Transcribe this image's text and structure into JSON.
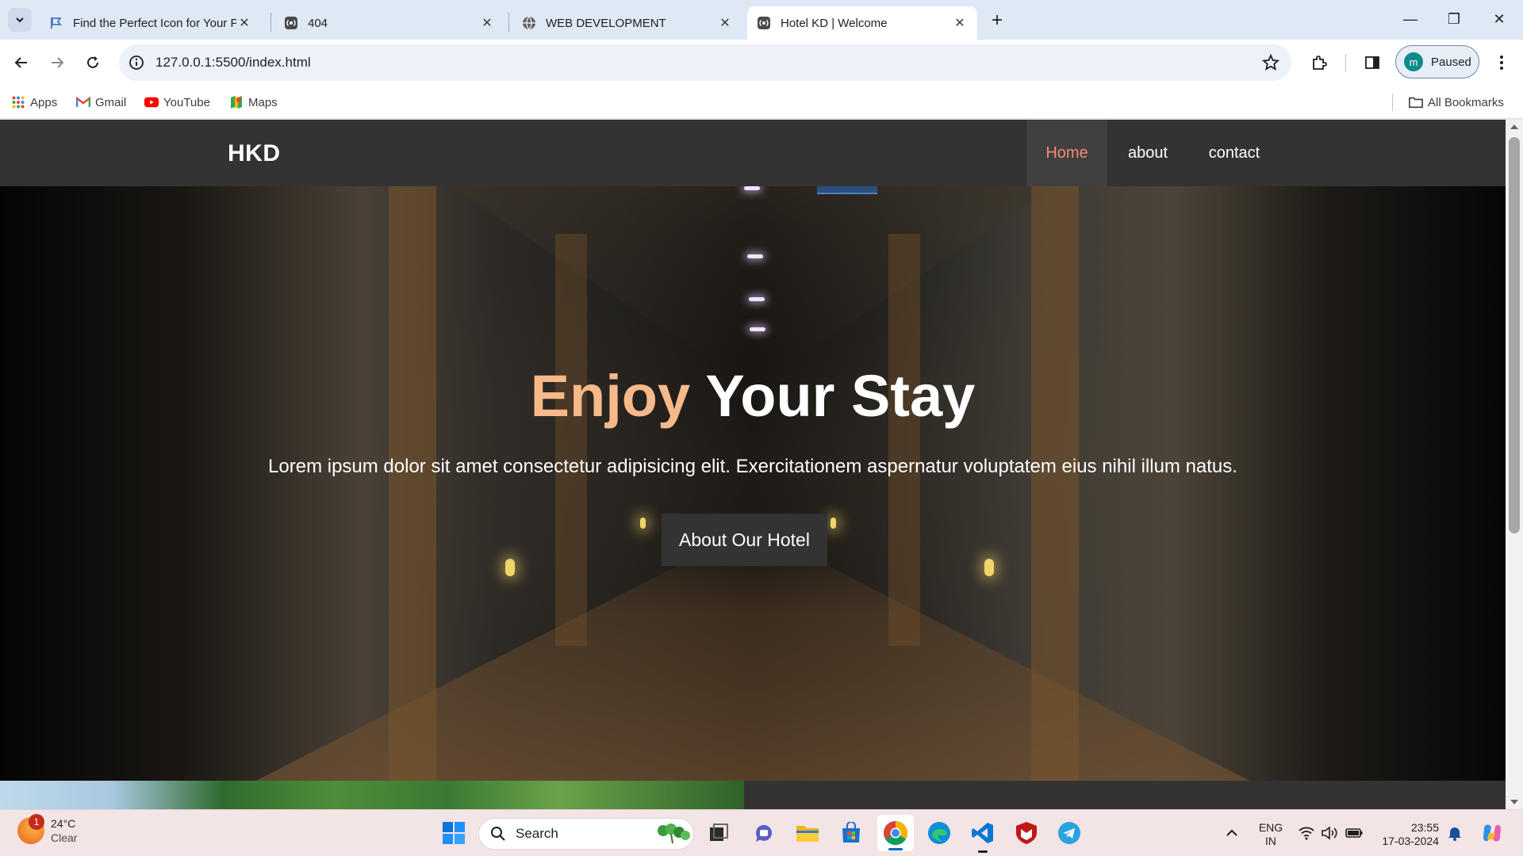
{
  "browser": {
    "tabs": [
      {
        "title": "Find the Perfect Icon for Your Pr",
        "icon": "flag-icon",
        "active": false
      },
      {
        "title": "404",
        "icon": "broadcast-icon",
        "active": false
      },
      {
        "title": "WEB DEVELOPMENT",
        "icon": "globe-icon",
        "active": false
      },
      {
        "title": "Hotel KD | Welcome",
        "icon": "broadcast-icon",
        "active": true
      }
    ],
    "close_glyph": "✕",
    "new_tab_glyph": "+",
    "window_controls": {
      "minimize": "—",
      "restore": "❐",
      "close": "✕"
    },
    "url": "127.0.0.1:5500/index.html",
    "profile": {
      "initial": "m",
      "status": "Paused"
    },
    "bookmarks": [
      {
        "label": "Apps",
        "icon": "apps-grid-icon"
      },
      {
        "label": "Gmail",
        "icon": "gmail-icon"
      },
      {
        "label": "YouTube",
        "icon": "youtube-icon"
      },
      {
        "label": "Maps",
        "icon": "maps-icon"
      }
    ],
    "all_bookmarks": "All Bookmarks"
  },
  "site": {
    "logo": "HKD",
    "nav": [
      {
        "label": "Home",
        "active": true
      },
      {
        "label": "about",
        "active": false
      },
      {
        "label": "contact",
        "active": false
      }
    ],
    "hero": {
      "headline_accent": "Enjoy",
      "headline_rest": " Your Stay",
      "tagline": "Lorem ipsum dolor sit amet consectetur adipisicing elit. Exercitationem aspernatur voluptatem eius nihil illum natus.",
      "cta": "About Our Hotel"
    },
    "colors": {
      "nav_bg": "#333333",
      "active_link": "#f28b76",
      "headline_accent": "#f6b98a"
    }
  },
  "taskbar": {
    "weather": {
      "temp": "24°C",
      "condition": "Clear",
      "alerts": "1"
    },
    "search_placeholder": "Search",
    "apps": [
      "windows-start-icon",
      "task-view-icon",
      "teams-chat-icon",
      "file-explorer-icon",
      "microsoft-store-icon",
      "chrome-icon",
      "edge-icon",
      "vscode-icon",
      "mcafee-icon",
      "telegram-icon"
    ],
    "language": {
      "line1": "ENG",
      "line2": "IN"
    },
    "time": "23:55",
    "date": "17-03-2024"
  }
}
